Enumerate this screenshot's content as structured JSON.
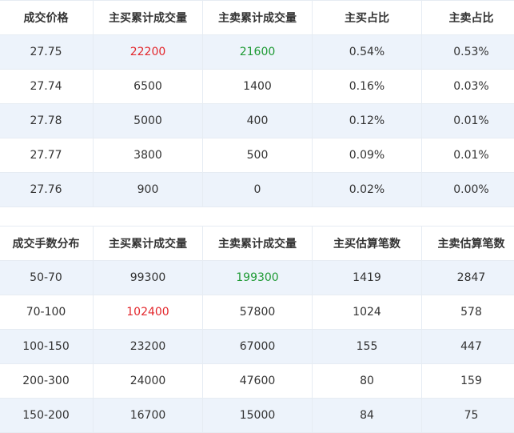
{
  "price_table": {
    "headers": [
      "成交价格",
      "主买累计成交量",
      "主卖累计成交量",
      "主买占比",
      "主卖占比"
    ],
    "rows": [
      {
        "price": "27.75",
        "buy_vol": "22200",
        "sell_vol": "21600",
        "buy_pct": "0.54%",
        "sell_pct": "0.53%"
      },
      {
        "price": "27.74",
        "buy_vol": "6500",
        "sell_vol": "1400",
        "buy_pct": "0.16%",
        "sell_pct": "0.03%"
      },
      {
        "price": "27.78",
        "buy_vol": "5000",
        "sell_vol": "400",
        "buy_pct": "0.12%",
        "sell_pct": "0.01%"
      },
      {
        "price": "27.77",
        "buy_vol": "3800",
        "sell_vol": "500",
        "buy_pct": "0.09%",
        "sell_pct": "0.01%"
      },
      {
        "price": "27.76",
        "buy_vol": "900",
        "sell_vol": "0",
        "buy_pct": "0.02%",
        "sell_pct": "0.00%"
      }
    ]
  },
  "lot_table": {
    "headers": [
      "成交手数分布",
      "主买累计成交量",
      "主卖累计成交量",
      "主买估算笔数",
      "主卖估算笔数"
    ],
    "rows": [
      {
        "range": "50-70",
        "buy_vol": "99300",
        "sell_vol": "199300",
        "buy_count": "1419",
        "sell_count": "2847"
      },
      {
        "range": "70-100",
        "buy_vol": "102400",
        "sell_vol": "57800",
        "buy_count": "1024",
        "sell_count": "578"
      },
      {
        "range": "100-150",
        "buy_vol": "23200",
        "sell_vol": "67000",
        "buy_count": "155",
        "sell_count": "447"
      },
      {
        "range": "200-300",
        "buy_vol": "24000",
        "sell_vol": "47600",
        "buy_count": "80",
        "sell_count": "159"
      },
      {
        "range": "150-200",
        "buy_vol": "16700",
        "sell_vol": "15000",
        "buy_count": "84",
        "sell_count": "75"
      }
    ]
  },
  "colors": {
    "up": "#e3282d",
    "down": "#1e9a34",
    "stripe": "#edf3fb",
    "border": "#e6ecf3"
  }
}
